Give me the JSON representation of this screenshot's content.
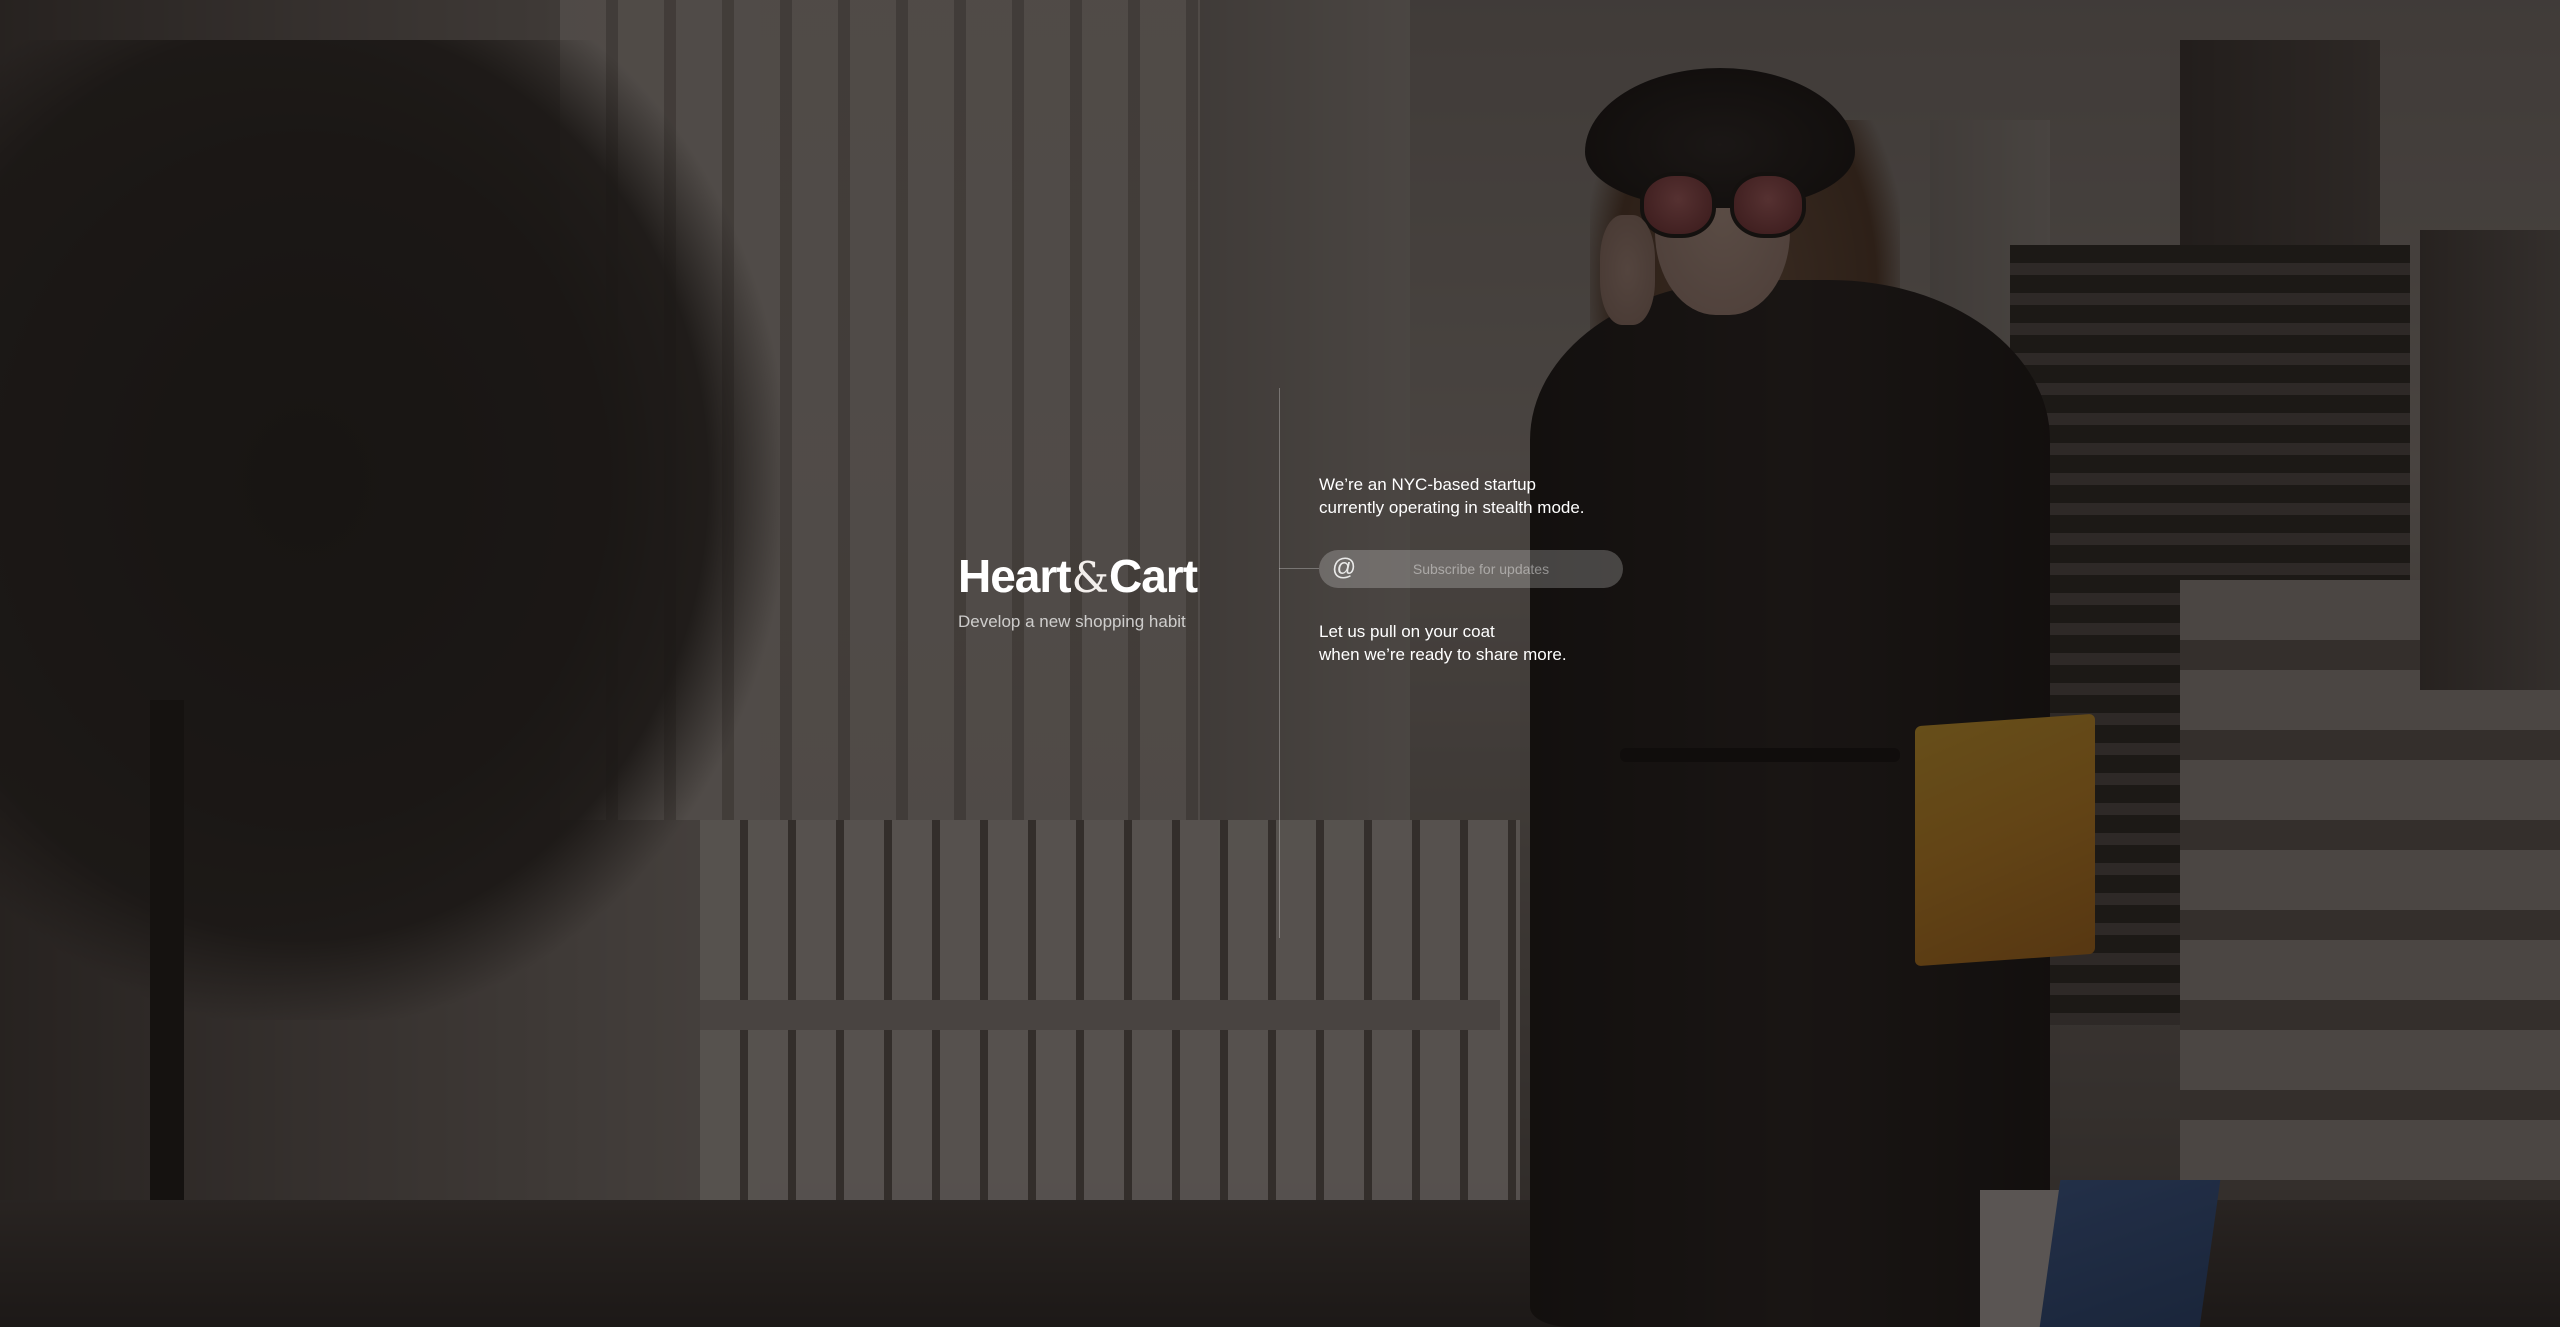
{
  "brand": {
    "name_part1": "Heart",
    "name_amp": "&",
    "name_part2": "Cart",
    "tagline": "Develop a new shopping habit"
  },
  "intro": {
    "line1": "We’re an NYC-based startup",
    "line2": "currently operating in stealth mode."
  },
  "subscribe": {
    "icon": "at-icon",
    "at_symbol": "@",
    "placeholder": "Subscribe for updates",
    "value": ""
  },
  "outro": {
    "line1": "Let us pull on your coat",
    "line2": "when we’re ready to share more."
  },
  "colors": {
    "overlay": "#120e0d",
    "text": "#ffffff",
    "input_bg": "#ffffff38",
    "bag_yellow": "#e59a24",
    "bag_blue": "#294c86"
  }
}
